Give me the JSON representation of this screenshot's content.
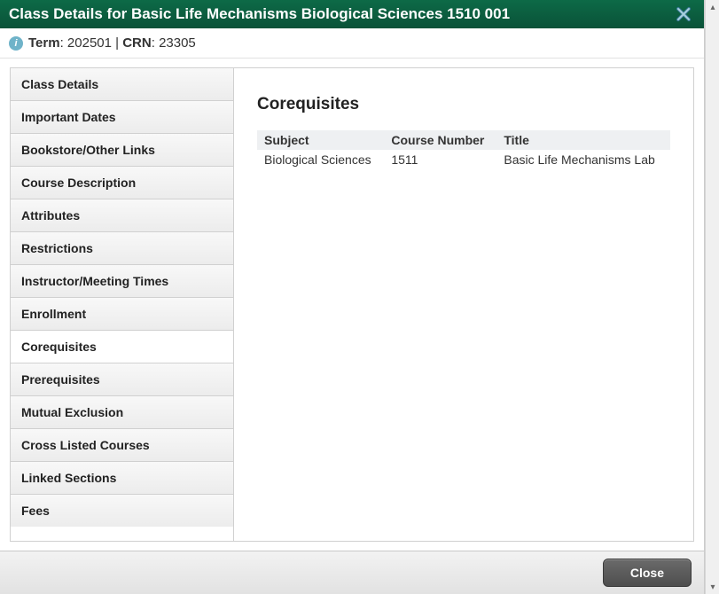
{
  "title": "Class Details for Basic Life Mechanisms Biological Sciences 1510 001",
  "subheader": {
    "term_label": "Term",
    "term_value": "202501",
    "crn_label": "CRN",
    "crn_value": "23305"
  },
  "tabs": [
    {
      "label": "Class Details"
    },
    {
      "label": "Important Dates"
    },
    {
      "label": "Bookstore/Other Links"
    },
    {
      "label": "Course Description"
    },
    {
      "label": "Attributes"
    },
    {
      "label": "Restrictions"
    },
    {
      "label": "Instructor/Meeting Times"
    },
    {
      "label": "Enrollment"
    },
    {
      "label": "Corequisites"
    },
    {
      "label": "Prerequisites"
    },
    {
      "label": "Mutual Exclusion"
    },
    {
      "label": "Cross Listed Courses"
    },
    {
      "label": "Linked Sections"
    },
    {
      "label": "Fees"
    }
  ],
  "active_tab_index": 8,
  "content": {
    "heading": "Corequisites",
    "columns": [
      "Subject",
      "Course Number",
      "Title"
    ],
    "rows": [
      {
        "subject": "Biological Sciences",
        "course_number": "1511",
        "title": "Basic Life Mechanisms Lab"
      }
    ]
  },
  "footer": {
    "close_label": "Close"
  }
}
